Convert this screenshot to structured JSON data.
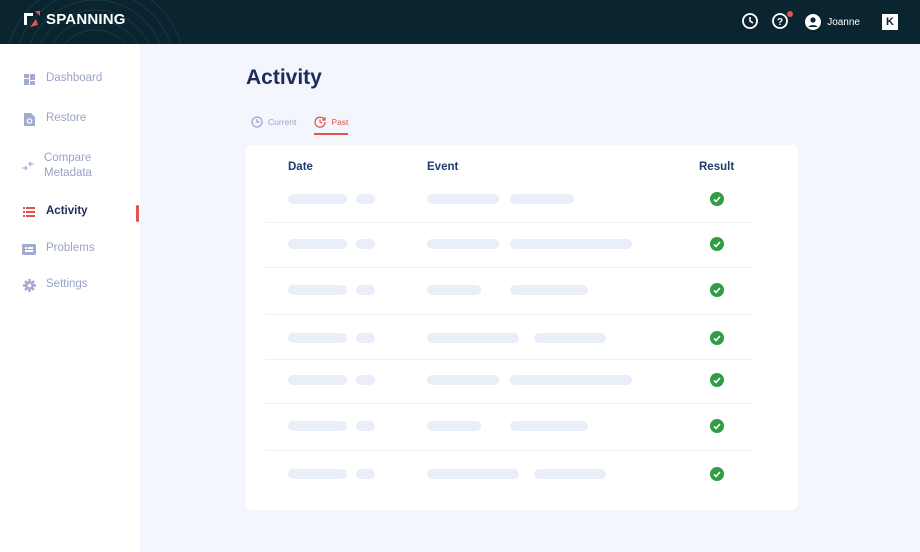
{
  "header": {
    "brand": "SPANNING",
    "user_name": "Joanne",
    "icons": [
      "history-icon",
      "help-icon",
      "user-icon",
      "k-badge-icon"
    ],
    "badge_letter": "K",
    "colors": {
      "bg": "#0a2530",
      "accent": "#e8524a"
    }
  },
  "sidebar": {
    "items": [
      {
        "label": "Dashboard",
        "icon": "dashboard-icon"
      },
      {
        "label": "Restore",
        "icon": "restore-icon"
      },
      {
        "label": "Compare Metadata",
        "icon": "compare-icon"
      },
      {
        "label": "Activity",
        "icon": "list-icon",
        "active": true
      },
      {
        "label": "Problems",
        "icon": "problems-icon"
      },
      {
        "label": "Settings",
        "icon": "gear-icon"
      }
    ]
  },
  "main": {
    "title": "Activity",
    "tabs": [
      {
        "label": "Current",
        "icon": "clock-icon"
      },
      {
        "label": "Past",
        "icon": "history-icon",
        "active": true
      }
    ],
    "table": {
      "columns": [
        "Date",
        "Event",
        "Result"
      ],
      "rows": [
        {
          "result": "success"
        },
        {
          "result": "success"
        },
        {
          "result": "success"
        },
        {
          "result": "success"
        },
        {
          "result": "success"
        },
        {
          "result": "success"
        },
        {
          "result": "success"
        }
      ],
      "loading": true
    }
  }
}
